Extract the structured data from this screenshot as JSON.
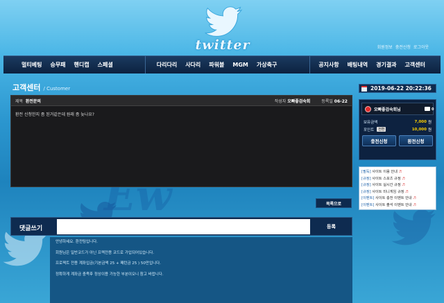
{
  "header": {
    "logo_text": "twitter",
    "member_links": [
      "회원정보",
      "충전신청",
      "로그아웃"
    ]
  },
  "nav": {
    "left": [
      "멀티베팅",
      "승무패",
      "핸디캡",
      "스페셜"
    ],
    "mid": [
      "다리다리",
      "사다리",
      "파워볼",
      "MGM",
      "가상축구"
    ],
    "right": [
      "공지사항",
      "배팅내역",
      "경기결과",
      "고객센터"
    ]
  },
  "page": {
    "title": "고객센터",
    "subtitle": "/ Customer"
  },
  "post": {
    "subject_label": "제목",
    "subject": "환전문의",
    "author_label": "작성자",
    "author": "오빠좋검숙회",
    "date_label": "등록일",
    "date": "06-22",
    "body": "환전 신청한지 좀 된거같은데 원래 좀 늦나요?"
  },
  "list_button": "목록으로",
  "comment": {
    "label": "댓글쓰기",
    "input_value": "",
    "submit": "등록"
  },
  "reply_lines": [
    "안녕하세요. 환전팀입니다.",
    "회원님은 일반코드가 아닌 프랙전용 코드로 가입되어있습니다.",
    "프로젝트 전용 계좌입금(기본금액 25 + 패턴금 25 ) 50만입니다.",
    "정확하게 계좌금 충족후 정상이용 가능한 부분이오니 참고 바랍니다."
  ],
  "sidebar": {
    "clock": "2019-06-22 20:22:36",
    "user_name": "오빠좋검숙회님",
    "message_count": "0",
    "balance_label": "보유금액",
    "balance_value": "7,000",
    "balance_unit": "원",
    "point_label": "포인트",
    "point_badge": "전환",
    "point_value": "10,000",
    "point_unit": "원",
    "charge_button": "충전신청",
    "withdraw_button": "환전신청",
    "notices": [
      {
        "cat": "[필독]",
        "text": " 사이트 이용 안내 ",
        "mark": "♬"
      },
      {
        "cat": "[규정]",
        "text": " 사이트 스포츠 규정 ",
        "mark": "♬"
      },
      {
        "cat": "[규정]",
        "text": " 사이트 실시간 규정 ",
        "mark": "♬"
      },
      {
        "cat": "[규정]",
        "text": " 사이트 미니게임 규정 ",
        "mark": "♬"
      },
      {
        "cat": "[이벤트]",
        "text": " 사이트 충전 이벤트 안내 ",
        "mark": "♬"
      },
      {
        "cat": "[이벤트]",
        "text": " 사이트 출석 이벤트 안내 ",
        "mark": "♬"
      }
    ]
  },
  "background": {
    "watermark_text": "Ew"
  },
  "colors": {
    "nav_bg": "#0c2240",
    "accent_yellow": "#ffd000",
    "avatar_red": "#e02b2b"
  }
}
